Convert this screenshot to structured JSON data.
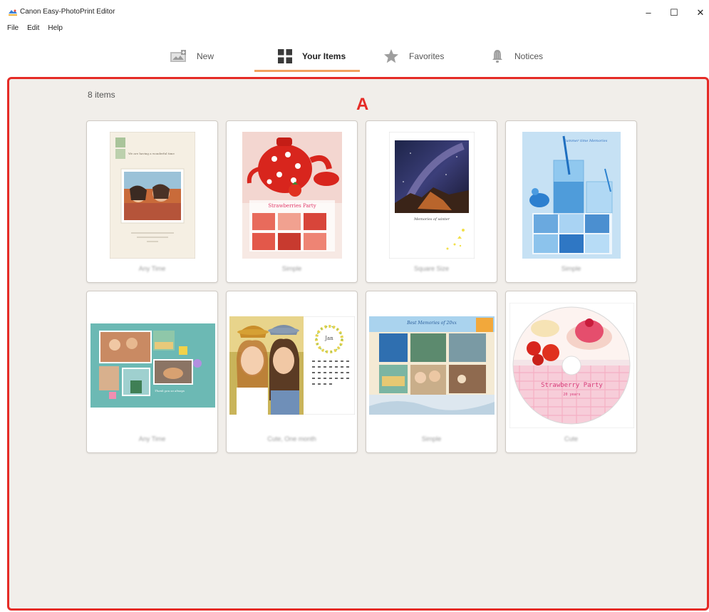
{
  "window": {
    "title": "Canon Easy-PhotoPrint Editor",
    "minimize": "–",
    "maximize": "☐",
    "close": "✕"
  },
  "menu": [
    "File",
    "Edit",
    "Help"
  ],
  "tabs": [
    {
      "label": "New",
      "icon": "new-image-icon"
    },
    {
      "label": "Your Items",
      "icon": "grid-icon",
      "selected": true
    },
    {
      "label": "Favorites",
      "icon": "star-icon"
    },
    {
      "label": "Notices",
      "icon": "bell-icon"
    }
  ],
  "main": {
    "item_count": "8 items",
    "callout_label": "A"
  },
  "items": [
    {
      "name": "Any Time",
      "thumbnail_text": "We are having a wonderful time"
    },
    {
      "name": "Simple",
      "thumbnail_text": "Strawberries Party"
    },
    {
      "name": "Square Size",
      "thumbnail_text": "Memories of winter"
    },
    {
      "name": "Simple",
      "thumbnail_text": "Summer time Memories"
    },
    {
      "name": "Any Time",
      "thumbnail_text": "Thank you so always"
    },
    {
      "name": "Cute, One month",
      "thumbnail_text": "Jan"
    },
    {
      "name": "Simple",
      "thumbnail_text": "Best Memories of 20xx"
    },
    {
      "name": "Cute",
      "thumbnail_text": "Strawberry Party",
      "thumbnail_subtext": "20 years"
    }
  ],
  "colors": {
    "accent": "#f2a15f",
    "highlight_border": "#e52b26",
    "content_background": "#f1eeea"
  }
}
